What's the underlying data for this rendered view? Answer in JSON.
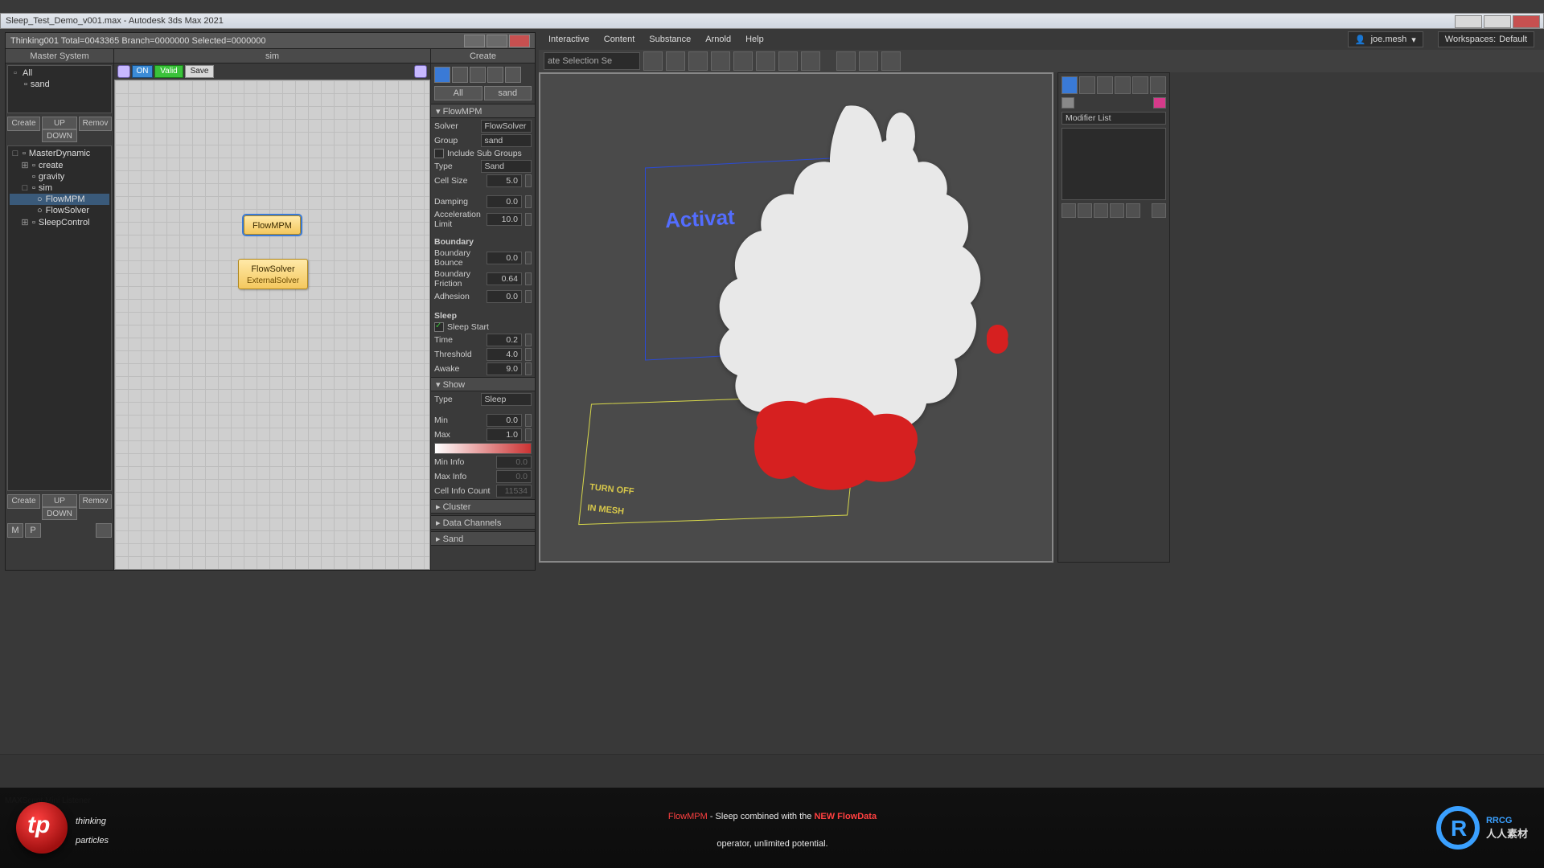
{
  "titlebar": {
    "text": "Sleep_Test_Demo_v001.max - Autodesk 3ds Max 2021"
  },
  "menubar": {
    "items": [
      "Interactive",
      "Content",
      "Substance",
      "Arnold",
      "Help"
    ],
    "user": "joe.mesh",
    "workspaces_label": "Workspaces:",
    "workspace": "Default"
  },
  "toolbar2": {
    "selset": "ate Selection Se"
  },
  "thinkwin": {
    "title": "Thinking001   Total=0043365   Branch=0000000  Selected=0000000",
    "master_hdr": "Master System",
    "tree1_all": "All",
    "tree1_sand": "sand",
    "btns": {
      "create": "Create",
      "remov": "Remov",
      "up": "UP",
      "down": "DOWN"
    },
    "tree2": {
      "root": "MasterDynamic",
      "children": [
        "create",
        "gravity",
        "sim",
        "SleepControl"
      ],
      "sim_children": [
        "FlowMPM",
        "FlowSolver"
      ]
    },
    "mp": {
      "m": "M",
      "p": "P"
    },
    "sim_hdr": "sim",
    "simbar": {
      "on": "ON",
      "valid": "Valid",
      "save": "Save"
    },
    "nodes": {
      "flowmpm": "FlowMPM",
      "flowsolver": "FlowSolver",
      "external": "ExternalSolver"
    }
  },
  "params": {
    "create_hdr": "Create",
    "tabs": {
      "all": "All",
      "sand": "sand"
    },
    "flowmpm_hdr": "FlowMPM",
    "solver_lbl": "Solver",
    "solver_val": "FlowSolver",
    "group_lbl": "Group",
    "group_val": "sand",
    "sub_lbl": "Include Sub Groups",
    "type_lbl": "Type",
    "type_val": "Sand",
    "cell_lbl": "Cell Size",
    "cell_val": "5.0",
    "damp_lbl": "Damping",
    "damp_val": "0.0",
    "accel_lbl": "Acceleration Limit",
    "accel_val": "10.0",
    "boundary_hdr": "Boundary",
    "bb_lbl": "Boundary Bounce",
    "bb_val": "0.0",
    "bf_lbl": "Boundary Friction",
    "bf_val": "0.64",
    "adh_lbl": "Adhesion",
    "adh_val": "0.0",
    "sleep_hdr": "Sleep",
    "ss_lbl": "Sleep Start",
    "time_lbl": "Time",
    "time_val": "0.2",
    "thr_lbl": "Threshold",
    "thr_val": "4.0",
    "aw_lbl": "Awake",
    "aw_val": "9.0",
    "show_hdr": "Show",
    "stype_lbl": "Type",
    "stype_val": "Sleep",
    "min_lbl": "Min",
    "min_val": "0.0",
    "max_lbl": "Max",
    "max_val": "1.0",
    "mininfo_lbl": "Min Info",
    "mininfo_val": "0.0",
    "maxinfo_lbl": "Max Info",
    "maxinfo_val": "0.0",
    "cellinfo_lbl": "Cell Info Count",
    "cellinfo_val": "11534",
    "cluster_hdr": "Cluster",
    "datach_hdr": "Data Channels",
    "sand_hdr": "Sand"
  },
  "viewport": {
    "activate": "Activat",
    "turnoff": "TURN OFF\nIN MESH"
  },
  "cmd": {
    "modlist": "Modifier List"
  },
  "caption": {
    "brand1": "thinking",
    "brand2": "particles",
    "line1a": "FlowMPM",
    "line1b": " - Sleep combined with the ",
    "line1c": "NEW FlowData",
    "line2": "operator, unlimited potential.",
    "rbrand": "RRCG",
    "rzh": "人人素材"
  },
  "listener": "MAXScript Mini Listener"
}
